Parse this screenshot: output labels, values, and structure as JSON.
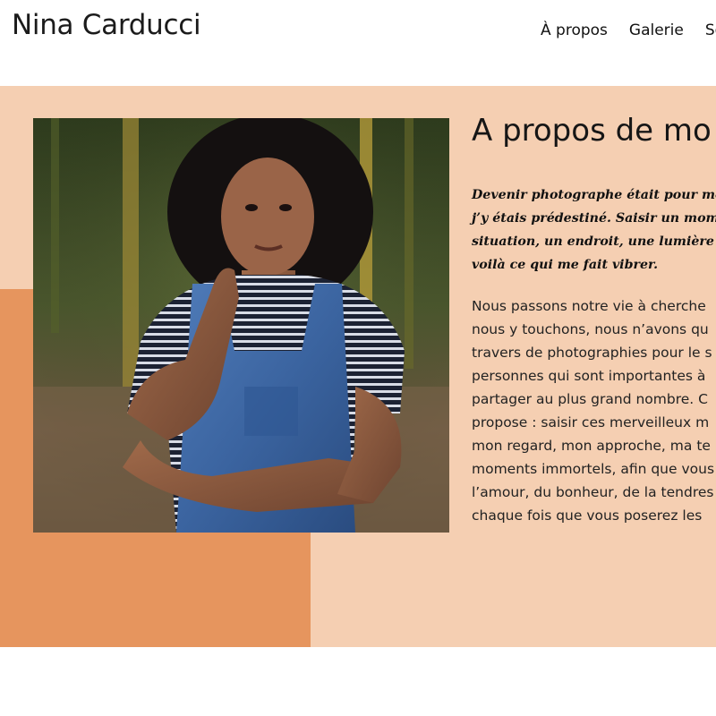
{
  "site": {
    "title": "Nina Carducci"
  },
  "nav": {
    "items": [
      "À propos",
      "Galerie",
      "Se"
    ]
  },
  "about": {
    "heading": "A propos de mo",
    "quote_lines": [
      "Devenir photographe était pour moi u",
      "j’y étais prédestiné. Saisir un moment",
      "situation, un endroit, une lumière et a",
      "voilà ce qui me fait vibrer."
    ],
    "body_lines": [
      "Nous passons notre vie à cherche",
      "nous y touchons, nous n’avons qu",
      "travers de photographies pour le s",
      "personnes qui sont importantes à",
      "partager au plus grand nombre. C",
      "propose : saisir ces merveilleux m",
      "mon regard, mon approche, ma te",
      "moments immortels, afin que vous",
      "l’amour, du bonheur, de la tendres",
      "chaque fois que vous poserez les"
    ]
  },
  "colors": {
    "section_bg": "#f5cfb2",
    "accent_block": "#e6955e",
    "text": "#111111"
  }
}
